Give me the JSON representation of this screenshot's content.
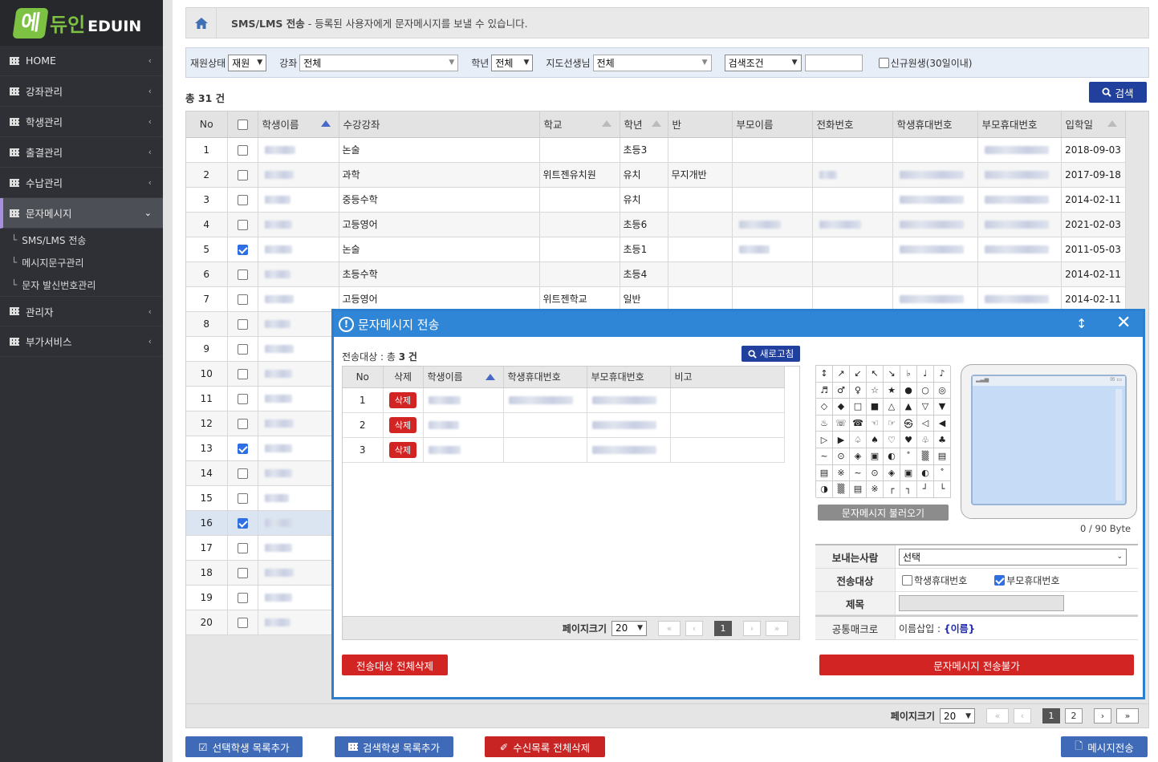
{
  "logo": {
    "mark": "에",
    "ko": "듀인",
    "en": "EDUIN"
  },
  "sidebar": {
    "items": [
      {
        "label": "HOME"
      },
      {
        "label": "강좌관리"
      },
      {
        "label": "학생관리"
      },
      {
        "label": "출결관리"
      },
      {
        "label": "수납관리"
      },
      {
        "label": "문자메시지"
      }
    ],
    "sub_items": [
      {
        "label": "SMS/LMS 전송"
      },
      {
        "label": "메시지문구관리"
      },
      {
        "label": "문자 발신번호관리"
      }
    ],
    "items_after": [
      {
        "label": "관리자"
      },
      {
        "label": "부가서비스"
      }
    ]
  },
  "breadcrumb": {
    "title": "SMS/LMS 전송",
    "desc": "- 등록된 사용자에게 문자메시지를 보낼 수 있습니다."
  },
  "filter": {
    "status_label": "재원상태",
    "status_value": "재원",
    "course_label": "강좌",
    "course_value": "전체",
    "grade_label": "학년",
    "grade_value": "전체",
    "teacher_label": "지도선생님",
    "teacher_value": "전체",
    "cond_value": "검색조건",
    "new_label": "신규원생(30일이내)"
  },
  "search_label": "검색",
  "total": {
    "prefix": "총",
    "count": "31",
    "suffix": "건"
  },
  "table": {
    "headers": {
      "no": "No",
      "name": "학생이름",
      "course": "수강강좌",
      "school": "학교",
      "grade": "학년",
      "class": "반",
      "parent": "부모이름",
      "phone": "전화번호",
      "student_mobile": "학생휴대번호",
      "parent_mobile": "부모휴대번호",
      "join": "입학일"
    },
    "rows": [
      {
        "no": "1",
        "course": "논술",
        "school": "",
        "grade": "초등3",
        "class": "",
        "join": "2018-09-03"
      },
      {
        "no": "2",
        "course": "과학",
        "school": "위트젠유치원",
        "grade": "유치",
        "class": "무지개반",
        "join": "2017-09-18"
      },
      {
        "no": "3",
        "course": "중등수학",
        "school": "",
        "grade": "유치",
        "class": "",
        "join": "2014-02-11"
      },
      {
        "no": "4",
        "course": "고등영어",
        "school": "",
        "grade": "초등6",
        "class": "",
        "join": "2021-02-03"
      },
      {
        "no": "5",
        "course": "논술",
        "school": "",
        "grade": "초등1",
        "class": "",
        "join": "2011-05-03"
      },
      {
        "no": "6",
        "course": "초등수학",
        "school": "",
        "grade": "초등4",
        "class": "",
        "join": "2014-02-11"
      },
      {
        "no": "7",
        "course": "고등영어",
        "school": "위트젠학교",
        "grade": "일반",
        "class": "",
        "join": "2014-02-11"
      },
      {
        "no": "8"
      },
      {
        "no": "9"
      },
      {
        "no": "10"
      },
      {
        "no": "11"
      },
      {
        "no": "12"
      },
      {
        "no": "13"
      },
      {
        "no": "14"
      },
      {
        "no": "15"
      },
      {
        "no": "16"
      },
      {
        "no": "17"
      },
      {
        "no": "18"
      },
      {
        "no": "19"
      },
      {
        "no": "20"
      }
    ]
  },
  "pager": {
    "label": "페이지크기",
    "size": "20",
    "pages": [
      "1",
      "2"
    ]
  },
  "bottom": {
    "add_selected": "선택학생 목록추가",
    "add_search": "검색학생 목록추가",
    "clear_recv": "수신목록 전체삭제",
    "send": "메시지전송"
  },
  "modal": {
    "title": "문자메시지 전송",
    "count_prefix": "전송대상 : 총",
    "count": "3",
    "count_suffix": "건",
    "refresh": "새로고침",
    "headers": {
      "no": "No",
      "del": "삭제",
      "name": "학생이름",
      "student_mobile": "학생휴대번호",
      "parent_mobile": "부모휴대번호",
      "note": "비고"
    },
    "rows": [
      {
        "no": "1",
        "del": "삭제"
      },
      {
        "no": "2",
        "del": "삭제"
      },
      {
        "no": "3",
        "del": "삭제"
      }
    ],
    "pager_label": "페이지크기",
    "pager_size": "20",
    "pager_page": "1",
    "delete_all": "전송대상 전체삭제",
    "symbols": [
      "↕",
      "↗",
      "↙",
      "↖",
      "↘",
      "♭",
      "♩",
      "♪",
      "♬",
      "♂",
      "♀",
      "☆",
      "★",
      "●",
      "○",
      "◎",
      "◇",
      "◆",
      "□",
      "■",
      "△",
      "▲",
      "▽",
      "▼",
      "♨",
      "☏",
      "☎",
      "☜",
      "☞",
      "㉿",
      "◁",
      "◀",
      "▷",
      "▶",
      "♤",
      "♠",
      "♡",
      "♥",
      "♧",
      "♣",
      "~",
      "⊙",
      "◈",
      "▣",
      "◐",
      "˚",
      "▒",
      "▤",
      "▤",
      "※",
      "~",
      "⊙",
      "◈",
      "▣",
      "◐",
      "˚",
      "◑",
      "▒",
      "▤",
      "※",
      "┌",
      "┐",
      "┘",
      "└"
    ],
    "load_msg": "문자메시지 불러오기",
    "bytes": "0 / 90 Byte",
    "sender_label": "보내는사람",
    "sender_value": "선택",
    "target_label": "전송대상",
    "target_student": "학생휴대번호",
    "target_parent": "부모휴대번호",
    "subject_label": "제목",
    "macro_label": "공통매크로",
    "macro_prefix": "이름삽입 :",
    "macro_value": "{이름}",
    "send_btn": "문자메시지 전송불가"
  }
}
